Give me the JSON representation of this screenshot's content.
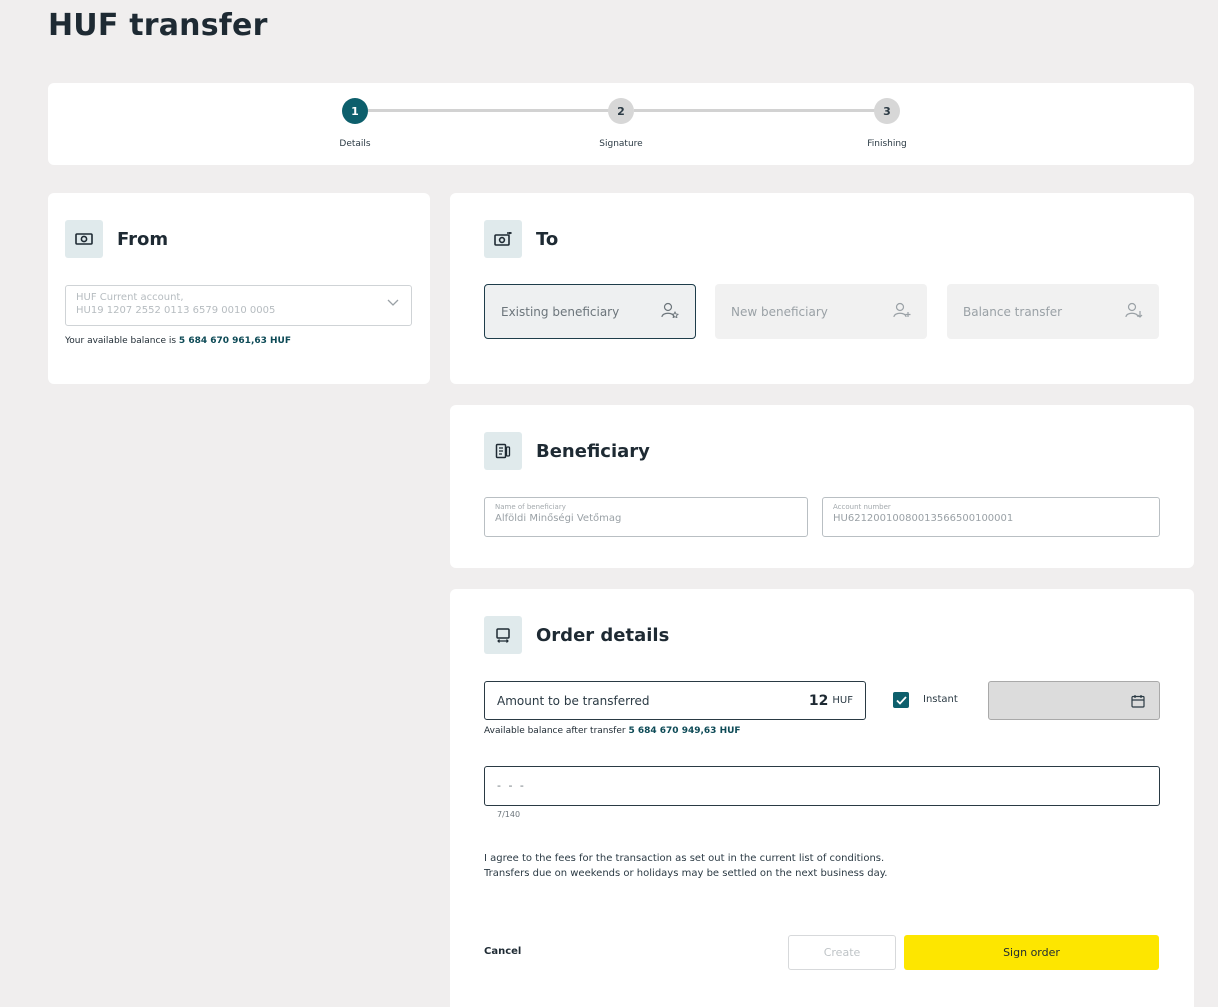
{
  "page": {
    "title": "HUF transfer"
  },
  "stepper": {
    "steps": [
      {
        "number": "1",
        "label": "Details"
      },
      {
        "number": "2",
        "label": "Signature"
      },
      {
        "number": "3",
        "label": "Finishing"
      }
    ]
  },
  "from": {
    "title": "From",
    "account_line1": "HUF Current account,",
    "account_line2": "HU19 1207 2552 0113 6579 0010 0005",
    "balance_prefix": "Your available balance is",
    "balance_value": "5 684 670 961,63 HUF"
  },
  "to": {
    "title": "To",
    "options": [
      {
        "label": "Existing beneficiary"
      },
      {
        "label": "New beneficiary"
      },
      {
        "label": "Balance transfer"
      }
    ]
  },
  "beneficiary": {
    "title": "Beneficiary",
    "name_label": "Name of beneficiary",
    "name_value": "Alföldi Minőségi Vetőmag",
    "account_label": "Account number",
    "account_value": "HU62120010080013566500100001"
  },
  "order": {
    "title": "Order details",
    "amount_label": "Amount to be transferred",
    "amount_value": "12",
    "currency": "HUF",
    "instant_label": "Instant",
    "after_prefix": "Available balance after transfer",
    "after_value": "5 684 670 949,63 HUF",
    "comment_value": "- - -",
    "counter": "7/140",
    "terms_line1": "I agree to the fees for the transaction as set out in the current list of conditions.",
    "terms_line2": "Transfers due on weekends or holidays may be settled on the next business day.",
    "cancel_label": "Cancel",
    "create_label": "Create",
    "sign_label": "Sign order"
  },
  "colors": {
    "accent": "#0d5f6c",
    "primary_button": "#fde600",
    "background": "#f0eeee"
  }
}
